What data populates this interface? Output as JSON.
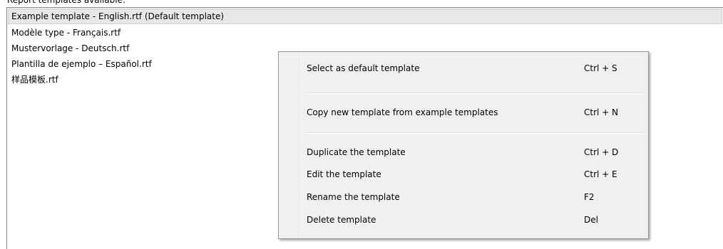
{
  "heading": "Report templates available:",
  "templates": [
    {
      "label": "Example template - English.rtf (Default template)",
      "selected": true
    },
    {
      "label": "Modèle type - Français.rtf",
      "selected": false
    },
    {
      "label": "Mustervorlage - Deutsch.rtf",
      "selected": false
    },
    {
      "label": "Plantilla de ejemplo – Español.rtf",
      "selected": false
    },
    {
      "label": "样品模板.rtf",
      "selected": false
    }
  ],
  "context_menu": {
    "items": [
      {
        "label": "Select as default template",
        "shortcut": "Ctrl + S"
      },
      {
        "label": "Copy new template from example templates",
        "shortcut": "Ctrl + N"
      },
      {
        "label": "Duplicate the template",
        "shortcut": "Ctrl + D"
      },
      {
        "label": "Edit the template",
        "shortcut": "Ctrl + E"
      },
      {
        "label": "Rename the template",
        "shortcut": "F2"
      },
      {
        "label": "Delete template",
        "shortcut": "Del"
      }
    ]
  }
}
